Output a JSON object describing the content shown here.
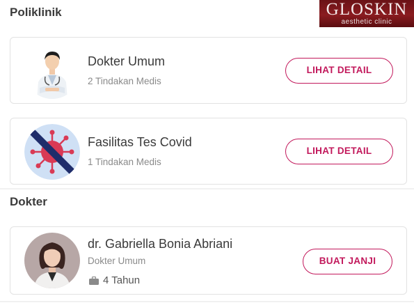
{
  "sections": {
    "poliklinik_title": "Poliklinik",
    "dokter_title": "Dokter"
  },
  "logo": {
    "brand": "GLOSKIN",
    "sub": "aesthetic clinic"
  },
  "polyclinics": [
    {
      "name": "Dokter Umum",
      "count_label": "2 Tindakan Medis",
      "button": "LIHAT DETAIL"
    },
    {
      "name": "Fasilitas Tes Covid",
      "count_label": "1 Tindakan Medis",
      "button": "LIHAT DETAIL"
    }
  ],
  "doctors": [
    {
      "name": "dr. Gabriella Bonia Abriani",
      "specialty": "Dokter Umum",
      "experience": "4 Tahun",
      "button": "BUAT JANJI"
    }
  ],
  "colors": {
    "accent": "#c2185b",
    "logo_bg": "#7a1519",
    "covid_bg": "#cfe0f5",
    "covid_virus": "#d93a55",
    "covid_strike": "#1f2d6b"
  },
  "icons": [
    "doctor-avatar",
    "covid-strike-icon",
    "briefcase-icon"
  ]
}
